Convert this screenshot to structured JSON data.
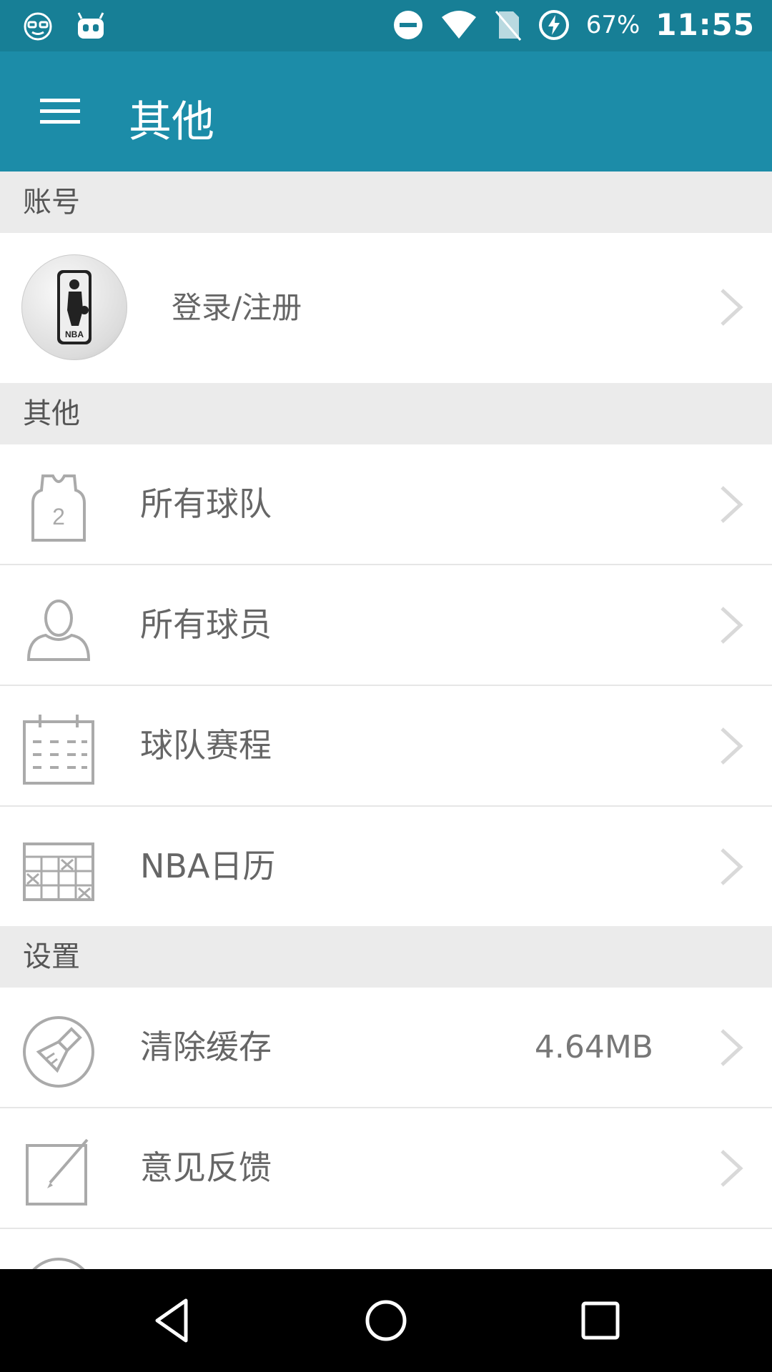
{
  "status_bar": {
    "battery": "67%",
    "time": "11:55"
  },
  "app_bar": {
    "title": "其他"
  },
  "sections": {
    "account": {
      "header": "账号",
      "login_label": "登录/注册"
    },
    "other": {
      "header": "其他",
      "items": [
        {
          "label": "所有球队",
          "icon": "jersey-icon"
        },
        {
          "label": "所有球员",
          "icon": "player-icon"
        },
        {
          "label": "球队赛程",
          "icon": "calendar-icon"
        },
        {
          "label": "NBA日历",
          "icon": "grid-calendar-icon"
        }
      ]
    },
    "settings": {
      "header": "设置",
      "items": [
        {
          "label": "清除缓存",
          "value": "4.64MB",
          "icon": "broom-icon"
        },
        {
          "label": "意见反馈",
          "icon": "edit-icon"
        }
      ]
    }
  },
  "colors": {
    "status_bar": "#177f96",
    "app_bar": "#1c8ca8",
    "section_header": "#ebebeb"
  }
}
